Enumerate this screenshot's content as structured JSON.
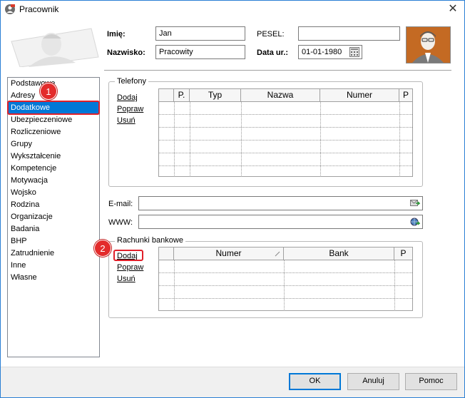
{
  "window": {
    "title": "Pracownik",
    "close_glyph": "✕"
  },
  "header": {
    "first_name_label": "Imię:",
    "first_name_value": "Jan",
    "last_name_label": "Nazwisko:",
    "last_name_value": "Pracowity",
    "pesel_label": "PESEL:",
    "pesel_value": "",
    "birth_date_label": "Data ur.:",
    "birth_date_value": "01-01-1980"
  },
  "nav": {
    "items": [
      {
        "label": "Podstawowe"
      },
      {
        "label": "Adresy"
      },
      {
        "label": "Dodatkowe"
      },
      {
        "label": "Ubezpieczeniowe"
      },
      {
        "label": "Rozliczeniowe"
      },
      {
        "label": "Grupy"
      },
      {
        "label": "Wykształcenie"
      },
      {
        "label": "Kompetencje"
      },
      {
        "label": "Motywacja"
      },
      {
        "label": "Wojsko"
      },
      {
        "label": "Rodzina"
      },
      {
        "label": "Organizacje"
      },
      {
        "label": "Badania"
      },
      {
        "label": "BHP"
      },
      {
        "label": "Zatrudnienie"
      },
      {
        "label": "Inne"
      },
      {
        "label": "Własne"
      }
    ],
    "selected": "Dodatkowe"
  },
  "phones": {
    "title": "Telefony",
    "add": "Dodaj",
    "edit": "Popraw",
    "delete": "Usuń",
    "columns": [
      "P.",
      "Typ",
      "Nazwa",
      "Numer",
      "P"
    ]
  },
  "contact": {
    "email_label": "E-mail:",
    "email_value": "",
    "www_label": "WWW:",
    "www_value": ""
  },
  "bank": {
    "title": "Rachunki bankowe",
    "add": "Dodaj",
    "edit": "Popraw",
    "delete": "Usuń",
    "columns": [
      "Numer",
      "Bank",
      "P"
    ]
  },
  "annotations": {
    "badge1": "1",
    "badge2": "2"
  },
  "buttons": {
    "ok": "OK",
    "cancel": "Anuluj",
    "help": "Pomoc"
  },
  "colors": {
    "selection": "#0078d7",
    "highlight": "#e0202a",
    "avatar_bg": "#c46a23"
  }
}
